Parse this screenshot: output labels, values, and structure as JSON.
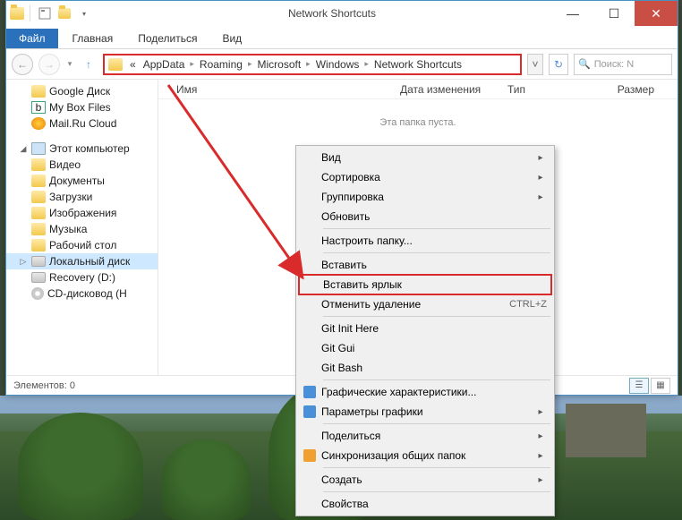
{
  "window": {
    "title": "Network Shortcuts"
  },
  "ribbon": {
    "file": "Файл",
    "home": "Главная",
    "share": "Поделиться",
    "view": "Вид"
  },
  "breadcrumb": {
    "prefix": "«",
    "items": [
      "AppData",
      "Roaming",
      "Microsoft",
      "Windows",
      "Network Shortcuts"
    ]
  },
  "search": {
    "placeholder": "Поиск: N"
  },
  "columns": {
    "name": "Имя",
    "date": "Дата изменения",
    "type": "Тип",
    "size": "Размер"
  },
  "empty": "Эта папка пуста.",
  "status": {
    "count_label": "Элементов:",
    "count": "0"
  },
  "tree": {
    "google_disk": "Google Диск",
    "my_box": "My Box Files",
    "mailru": "Mail.Ru Cloud",
    "this_pc": "Этот компьютер",
    "video": "Видео",
    "documents": "Документы",
    "downloads": "Загрузки",
    "pictures": "Изображения",
    "music": "Музыка",
    "desktop": "Рабочий стол",
    "local_disk": "Локальный диск",
    "recovery": "Recovery (D:)",
    "cd_drive": "CD-дисковод (H"
  },
  "ctx": {
    "view": "Вид",
    "sort": "Сортировка",
    "group": "Группировка",
    "refresh": "Обновить",
    "customize": "Настроить папку...",
    "paste": "Вставить",
    "paste_shortcut": "Вставить ярлык",
    "undo_delete": "Отменить удаление",
    "undo_shortcut": "CTRL+Z",
    "git_init": "Git Init Here",
    "git_gui": "Git Gui",
    "git_bash": "Git Bash",
    "gfx_chars": "Графические характеристики...",
    "gfx_params": "Параметры графики",
    "share": "Поделиться",
    "sync": "Синхронизация общих папок",
    "new": "Создать",
    "properties": "Свойства"
  }
}
